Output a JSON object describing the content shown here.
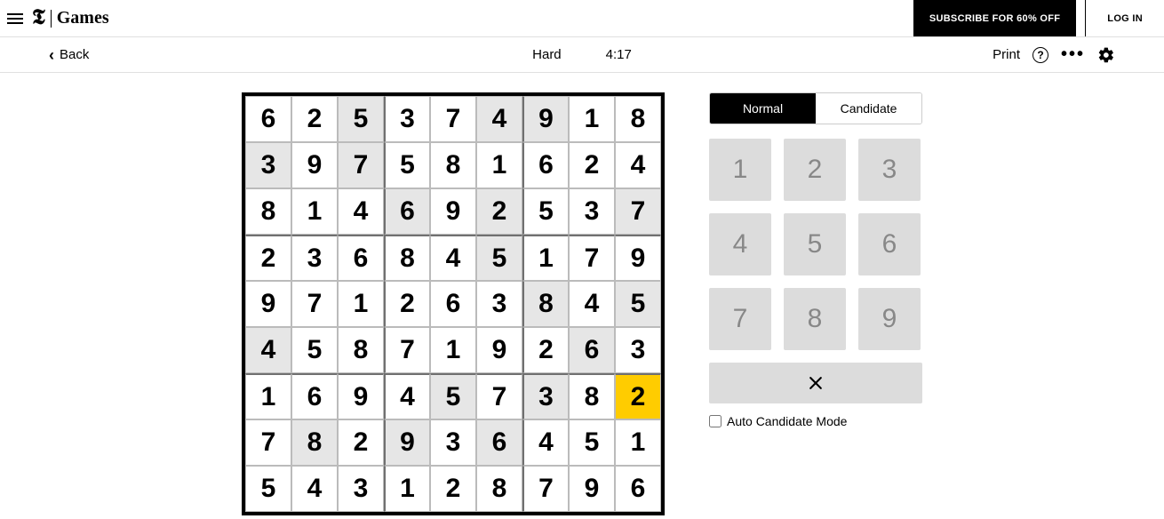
{
  "header": {
    "brand_name": "Games",
    "subscribe_label": "SUBSCRIBE FOR 60% OFF",
    "login_label": "LOG IN"
  },
  "subbar": {
    "back_label": "Back",
    "difficulty": "Hard",
    "timer": "4:17",
    "print_label": "Print"
  },
  "mode": {
    "normal": "Normal",
    "candidate": "Candidate",
    "active": "normal"
  },
  "keypad": [
    "1",
    "2",
    "3",
    "4",
    "5",
    "6",
    "7",
    "8",
    "9"
  ],
  "auto_label": "Auto Candidate Mode",
  "board": {
    "selected": [
      6,
      8
    ],
    "rows": [
      [
        {
          "v": "6"
        },
        {
          "v": "2"
        },
        {
          "v": "5",
          "p": true
        },
        {
          "v": "3"
        },
        {
          "v": "7"
        },
        {
          "v": "4",
          "p": true
        },
        {
          "v": "9",
          "p": true
        },
        {
          "v": "1"
        },
        {
          "v": "8"
        }
      ],
      [
        {
          "v": "3",
          "p": true
        },
        {
          "v": "9"
        },
        {
          "v": "7",
          "p": true
        },
        {
          "v": "5"
        },
        {
          "v": "8"
        },
        {
          "v": "1"
        },
        {
          "v": "6"
        },
        {
          "v": "2"
        },
        {
          "v": "4"
        }
      ],
      [
        {
          "v": "8"
        },
        {
          "v": "1"
        },
        {
          "v": "4"
        },
        {
          "v": "6",
          "p": true
        },
        {
          "v": "9"
        },
        {
          "v": "2",
          "p": true
        },
        {
          "v": "5"
        },
        {
          "v": "3"
        },
        {
          "v": "7",
          "p": true
        }
      ],
      [
        {
          "v": "2"
        },
        {
          "v": "3"
        },
        {
          "v": "6"
        },
        {
          "v": "8"
        },
        {
          "v": "4"
        },
        {
          "v": "5",
          "p": true
        },
        {
          "v": "1"
        },
        {
          "v": "7"
        },
        {
          "v": "9"
        }
      ],
      [
        {
          "v": "9"
        },
        {
          "v": "7"
        },
        {
          "v": "1"
        },
        {
          "v": "2"
        },
        {
          "v": "6"
        },
        {
          "v": "3"
        },
        {
          "v": "8",
          "p": true
        },
        {
          "v": "4"
        },
        {
          "v": "5",
          "p": true
        }
      ],
      [
        {
          "v": "4",
          "p": true
        },
        {
          "v": "5"
        },
        {
          "v": "8"
        },
        {
          "v": "7"
        },
        {
          "v": "1"
        },
        {
          "v": "9"
        },
        {
          "v": "2"
        },
        {
          "v": "6",
          "p": true
        },
        {
          "v": "3"
        }
      ],
      [
        {
          "v": "1"
        },
        {
          "v": "6"
        },
        {
          "v": "9"
        },
        {
          "v": "4"
        },
        {
          "v": "5",
          "p": true
        },
        {
          "v": "7"
        },
        {
          "v": "3",
          "p": true
        },
        {
          "v": "8"
        },
        {
          "v": "2"
        }
      ],
      [
        {
          "v": "7"
        },
        {
          "v": "8",
          "p": true
        },
        {
          "v": "2"
        },
        {
          "v": "9",
          "p": true
        },
        {
          "v": "3"
        },
        {
          "v": "6",
          "p": true
        },
        {
          "v": "4"
        },
        {
          "v": "5"
        },
        {
          "v": "1"
        }
      ],
      [
        {
          "v": "5"
        },
        {
          "v": "4"
        },
        {
          "v": "3"
        },
        {
          "v": "1"
        },
        {
          "v": "2"
        },
        {
          "v": "8"
        },
        {
          "v": "7"
        },
        {
          "v": "9"
        },
        {
          "v": "6"
        }
      ]
    ]
  }
}
